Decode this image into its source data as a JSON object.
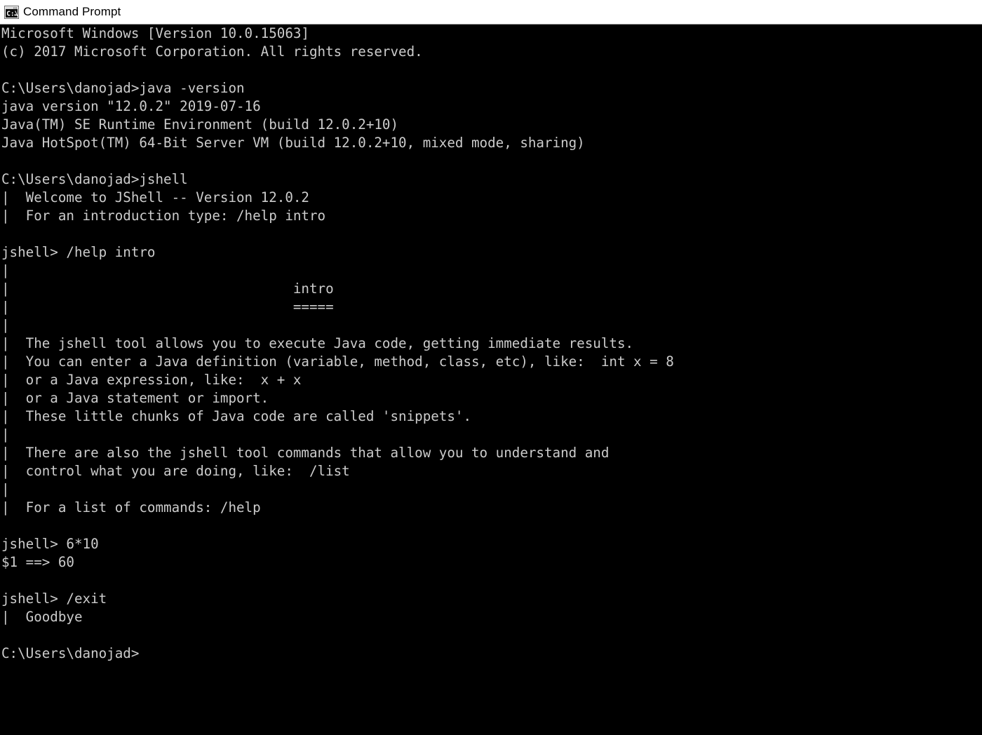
{
  "window": {
    "title": "Command Prompt",
    "icon": "command-prompt-icon",
    "icon_label": "C:\\",
    "titlebar_bg": "#ffffff",
    "titlebar_fg": "#000000",
    "console_bg": "#000000",
    "console_fg": "#cccccc"
  },
  "console": {
    "lines": [
      "Microsoft Windows [Version 10.0.15063]",
      "(c) 2017 Microsoft Corporation. All rights reserved.",
      "",
      "C:\\Users\\danojad>java -version",
      "java version \"12.0.2\" 2019-07-16",
      "Java(TM) SE Runtime Environment (build 12.0.2+10)",
      "Java HotSpot(TM) 64-Bit Server VM (build 12.0.2+10, mixed mode, sharing)",
      "",
      "C:\\Users\\danojad>jshell",
      "|  Welcome to JShell -- Version 12.0.2",
      "|  For an introduction type: /help intro",
      "",
      "jshell> /help intro",
      "|",
      "|                                   intro",
      "|                                   =====",
      "|",
      "|  The jshell tool allows you to execute Java code, getting immediate results.",
      "|  You can enter a Java definition (variable, method, class, etc), like:  int x = 8",
      "|  or a Java expression, like:  x + x",
      "|  or a Java statement or import.",
      "|  These little chunks of Java code are called 'snippets'.",
      "|",
      "|  There are also the jshell tool commands that allow you to understand and",
      "|  control what you are doing, like:  /list",
      "|",
      "|  For a list of commands: /help",
      "",
      "jshell> 6*10",
      "$1 ==> 60",
      "",
      "jshell> /exit",
      "|  Goodbye",
      "",
      "C:\\Users\\danojad>"
    ],
    "text": "Microsoft Windows [Version 10.0.15063]\n(c) 2017 Microsoft Corporation. All rights reserved.\n\nC:\\Users\\danojad>java -version\njava version \"12.0.2\" 2019-07-16\nJava(TM) SE Runtime Environment (build 12.0.2+10)\nJava HotSpot(TM) 64-Bit Server VM (build 12.0.2+10, mixed mode, sharing)\n\nC:\\Users\\danojad>jshell\n|  Welcome to JShell -- Version 12.0.2\n|  For an introduction type: /help intro\n\njshell> /help intro\n|\n|                                   intro\n|                                   =====\n|\n|  The jshell tool allows you to execute Java code, getting immediate results.\n|  You can enter a Java definition (variable, method, class, etc), like:  int x = 8\n|  or a Java expression, like:  x + x\n|  or a Java statement or import.\n|  These little chunks of Java code are called 'snippets'.\n|\n|  There are also the jshell tool commands that allow you to understand and\n|  control what you are doing, like:  /list\n|\n|  For a list of commands: /help\n\njshell> 6*10\n$1 ==> 60\n\njshell> /exit\n|  Goodbye\n\nC:\\Users\\danojad>",
    "prompt": "C:\\Users\\danojad>",
    "jshell_prompt": "jshell>",
    "commands_entered": [
      "java -version",
      "jshell",
      "/help intro",
      "6*10",
      "/exit"
    ],
    "result_value": "60",
    "result_name": "$1"
  }
}
